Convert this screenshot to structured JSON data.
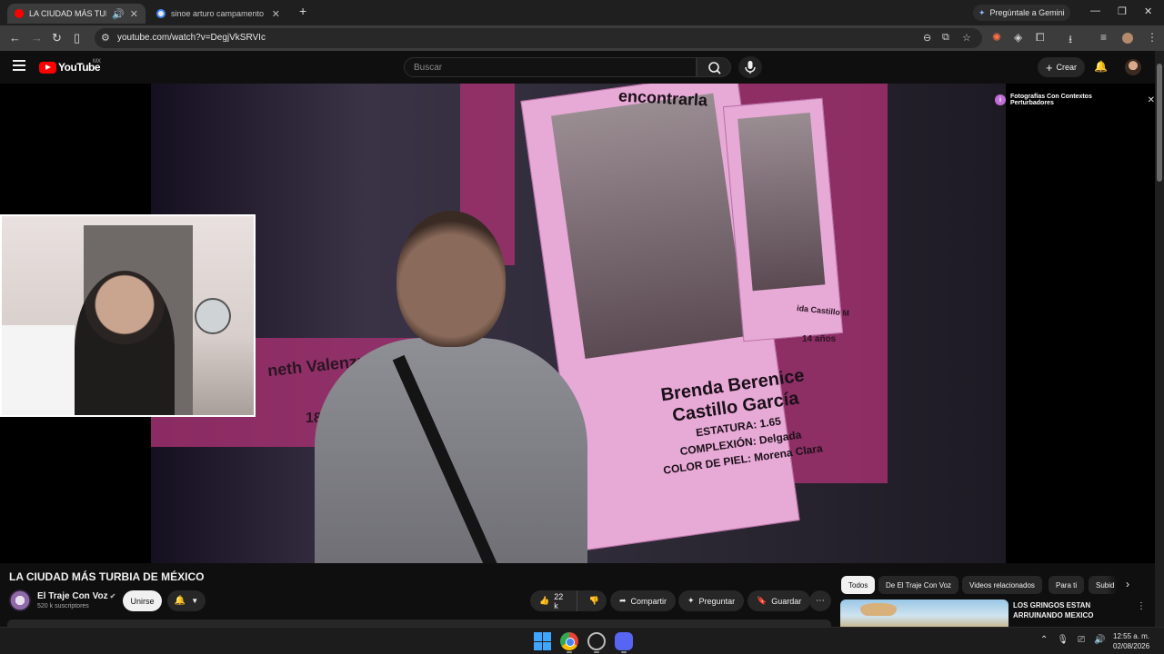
{
  "browser": {
    "tabs": [
      {
        "title": "LA CIUDAD MÁS TURBIA DE",
        "active": true,
        "favicon_color": "#ff0000"
      },
      {
        "title": "sinoe arturo campamento - Bus",
        "active": false,
        "favicon_color": "#ffffff"
      }
    ],
    "new_tab": "+",
    "gemini_label": "Pregúntale a Gemini",
    "url": "youtube.com/watch?v=DegjVkSRVIc"
  },
  "youtube": {
    "logo_text": "YouTube",
    "region": "MX",
    "search_placeholder": "Buscar",
    "create_label": "Crear"
  },
  "video": {
    "disclaimer": "Fotografías Con Contextos Perturbadores",
    "scene": {
      "top_text": "encontrarla",
      "poster_name_1": "Brenda Berenice",
      "poster_name_2": "Castillo García",
      "poster_line_1": "ESTATURA: 1.65",
      "poster_line_2": "COMPLEXIÓN: Delgada",
      "poster_line_3": "COLOR DE PIEL: Morena Clara",
      "left_name": "neth Valenzue",
      "left_age": "18 a",
      "right_name": "ida Castillo M",
      "right_age": "14 años"
    }
  },
  "details": {
    "title": "LA CIUDAD MÁS TURBIA DE MÉXICO",
    "channel": "El Traje Con Voz",
    "subscribers": "520 k suscriptores",
    "join": "Unirse",
    "likes": "22 k",
    "share": "Compartir",
    "ask": "Preguntar",
    "save": "Guardar"
  },
  "sidebar": {
    "chips": [
      "Todos",
      "De El Traje Con Voz",
      "Videos relacionados",
      "Para ti",
      "Subid"
    ],
    "selected_chip": "Todos",
    "recommended": [
      {
        "title": "LOS GRINGOS ESTAN ARRUINANDO MEXICO"
      }
    ]
  },
  "taskbar": {
    "time": "12:55 a. m.",
    "date": "02/08/2026"
  },
  "colors": {
    "youtube_red": "#ff0000",
    "background": "#0f0f0f",
    "poster_pink": "#e7a9d6"
  }
}
